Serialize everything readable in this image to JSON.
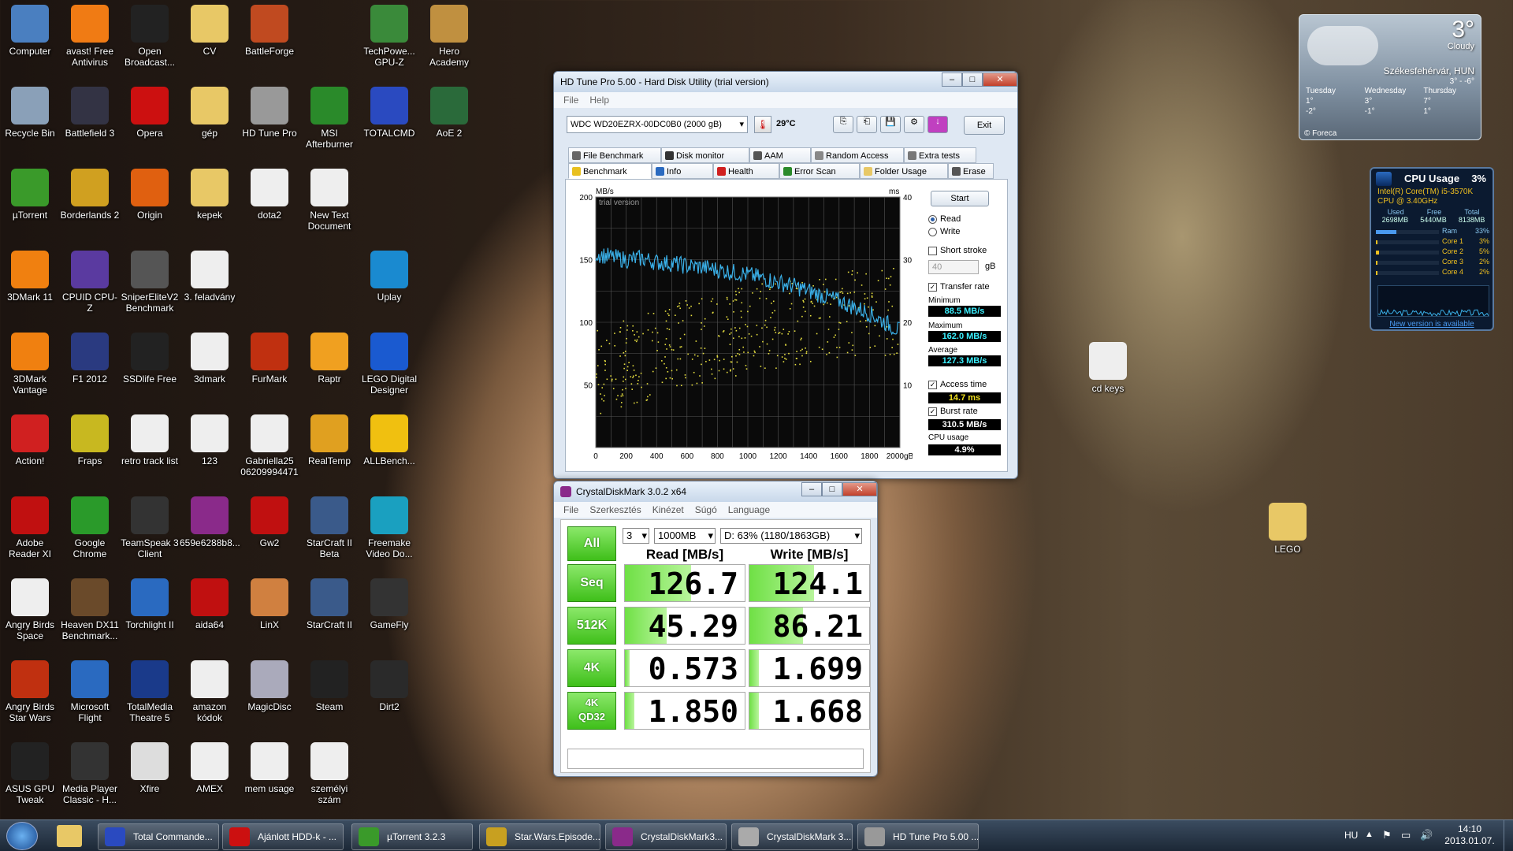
{
  "desktop_icons": [
    {
      "label": "Computer",
      "color": "#4a7fc0"
    },
    {
      "label": "avast! Free Antivirus",
      "color": "#f07b14"
    },
    {
      "label": "Open Broadcast...",
      "color": "#222"
    },
    {
      "label": "CV",
      "color": "#e8c866"
    },
    {
      "label": "BattleForge",
      "color": "#c04a20"
    },
    {
      "label": "TechPowe... GPU-Z",
      "color": "#3a8a3a"
    },
    {
      "label": "Hero Academy",
      "color": "#c09040"
    },
    {
      "label": "Recycle Bin",
      "color": "#8aa0b8"
    },
    {
      "label": "Battlefield 3",
      "color": "#334"
    },
    {
      "label": "Opera",
      "color": "#cc1010"
    },
    {
      "label": "gép",
      "color": "#e8c866"
    },
    {
      "label": "HD Tune Pro",
      "color": "#999"
    },
    {
      "label": "MSI Afterburner",
      "color": "#2a8a2a"
    },
    {
      "label": "TOTALCMD",
      "color": "#2a4ac0"
    },
    {
      "label": "AoE 2",
      "color": "#2a6a3a"
    },
    {
      "label": "µTorrent",
      "color": "#3a9a2a"
    },
    {
      "label": "Borderlands 2",
      "color": "#d0a020"
    },
    {
      "label": "Origin",
      "color": "#e06010"
    },
    {
      "label": "kepek",
      "color": "#e8c866"
    },
    {
      "label": "dota2",
      "color": "#eee"
    },
    {
      "label": "New Text Document",
      "color": "#eee"
    },
    {
      "label": "3DMark 11",
      "color": "#f08010"
    },
    {
      "label": "CPUID CPU-Z",
      "color": "#5a3aa0"
    },
    {
      "label": "SniperEliteV2 Benchmark",
      "color": "#555"
    },
    {
      "label": "3. feladvány",
      "color": "#eee"
    },
    {
      "label": "Uplay",
      "color": "#1a8ad0"
    },
    {
      "label": "3DMark Vantage",
      "color": "#f08010"
    },
    {
      "label": "F1 2012",
      "color": "#2a3a80"
    },
    {
      "label": "SSDlife Free",
      "color": "#222"
    },
    {
      "label": "3dmark",
      "color": "#eee"
    },
    {
      "label": "FurMark",
      "color": "#c03010"
    },
    {
      "label": "Raptr",
      "color": "#f0a020"
    },
    {
      "label": "LEGO Digital Designer",
      "color": "#1a5ad0"
    },
    {
      "label": "Action!",
      "color": "#d02020"
    },
    {
      "label": "Fraps",
      "color": "#c8b820"
    },
    {
      "label": "retro track list",
      "color": "#eee"
    },
    {
      "label": "123",
      "color": "#eee"
    },
    {
      "label": "Gabriella25 06209994471",
      "color": "#eee"
    },
    {
      "label": "RealTemp",
      "color": "#e0a020"
    },
    {
      "label": "ALLBench...",
      "color": "#f0c010"
    },
    {
      "label": "Adobe Reader XI",
      "color": "#c01010"
    },
    {
      "label": "Google Chrome",
      "color": "#2a9a2a"
    },
    {
      "label": "TeamSpeak 3 Client",
      "color": "#333"
    },
    {
      "label": "659e6288b8...",
      "color": "#8a2a8a"
    },
    {
      "label": "Gw2",
      "color": "#c01010"
    },
    {
      "label": "StarCraft II Beta",
      "color": "#3a5a8a"
    },
    {
      "label": "Freemake Video Do...",
      "color": "#1aa0c0"
    },
    {
      "label": "Angry Birds Space",
      "color": "#eee"
    },
    {
      "label": "Heaven DX11 Benchmark...",
      "color": "#6a4a2a"
    },
    {
      "label": "Torchlight II",
      "color": "#2a6ac0"
    },
    {
      "label": "aida64",
      "color": "#c01010"
    },
    {
      "label": "LinX",
      "color": "#d08040"
    },
    {
      "label": "StarCraft II",
      "color": "#3a5a8a"
    },
    {
      "label": "GameFly",
      "color": "#333"
    },
    {
      "label": "Angry Birds Star Wars",
      "color": "#c03010"
    },
    {
      "label": "Microsoft Flight",
      "color": "#2a6ac0"
    },
    {
      "label": "TotalMedia Theatre 5",
      "color": "#1a3a8a"
    },
    {
      "label": "amazon kódok",
      "color": "#eee"
    },
    {
      "label": "MagicDisc",
      "color": "#aab"
    },
    {
      "label": "Steam",
      "color": "#222"
    },
    {
      "label": "Dirt2",
      "color": "#2a2a2a"
    },
    {
      "label": "ASUS GPU Tweak",
      "color": "#222"
    },
    {
      "label": "Media Player Classic - H...",
      "color": "#333"
    },
    {
      "label": "Xfire",
      "color": "#ddd"
    },
    {
      "label": "AMEX",
      "color": "#eee"
    },
    {
      "label": "mem usage",
      "color": "#eee"
    },
    {
      "label": "személyi szám",
      "color": "#eee"
    },
    {
      "label": "cd keys",
      "color": "#eee"
    },
    {
      "label": "LEGO",
      "color": "#e8c866"
    }
  ],
  "hdtune": {
    "title": "HD Tune Pro 5.00 - Hard Disk Utility (trial version)",
    "menu": [
      "File",
      "Help"
    ],
    "drive": "WDC WD20EZRX-00DC0B0 (2000 gB)",
    "temp": "29°C",
    "exit": "Exit",
    "tabs_top": [
      "File Benchmark",
      "Disk monitor",
      "AAM",
      "Random Access",
      "Extra tests"
    ],
    "tabs_bottom": [
      "Benchmark",
      "Info",
      "Health",
      "Error Scan",
      "Folder Usage",
      "Erase"
    ],
    "start": "Start",
    "read": "Read",
    "write": "Write",
    "short_stroke": "Short stroke",
    "stroke_value": "40",
    "gb": "gB",
    "transfer_rate": "Transfer rate",
    "minimum_label": "Minimum",
    "minimum": "88.5 MB/s",
    "maximum_label": "Maximum",
    "maximum": "162.0 MB/s",
    "average_label": "Average",
    "average": "127.3 MB/s",
    "access_label": "Access time",
    "access": "14.7 ms",
    "burst_label": "Burst rate",
    "burst": "310.5 MB/s",
    "cpu_label": "CPU usage",
    "cpu": "4.9%",
    "chart_watermark": "trial version",
    "y_unit_left": "MB/s",
    "y_unit_right": "ms"
  },
  "chart_data": {
    "type": "line",
    "title": "",
    "xlabel": "",
    "ylabel": "MB/s",
    "x_ticks": [
      "0",
      "200",
      "400",
      "600",
      "800",
      "1000",
      "1200",
      "1400",
      "1600",
      "1800",
      "2000gB"
    ],
    "y_ticks_left": [
      "200",
      "150",
      "100",
      "50"
    ],
    "y_ticks_right": [
      "40",
      "30",
      "20",
      "10"
    ],
    "xlim": [
      0,
      2000
    ],
    "ylim": [
      0,
      200
    ],
    "y2lim": [
      0,
      40
    ],
    "series": [
      {
        "name": "Transfer rate",
        "values": [
          {
            "x": 0,
            "y": 155
          },
          {
            "x": 100,
            "y": 152
          },
          {
            "x": 200,
            "y": 150
          },
          {
            "x": 300,
            "y": 151
          },
          {
            "x": 400,
            "y": 148
          },
          {
            "x": 500,
            "y": 147
          },
          {
            "x": 600,
            "y": 145
          },
          {
            "x": 700,
            "y": 144
          },
          {
            "x": 800,
            "y": 142
          },
          {
            "x": 900,
            "y": 140
          },
          {
            "x": 1000,
            "y": 138
          },
          {
            "x": 1100,
            "y": 135
          },
          {
            "x": 1200,
            "y": 132
          },
          {
            "x": 1300,
            "y": 129
          },
          {
            "x": 1400,
            "y": 125
          },
          {
            "x": 1500,
            "y": 121
          },
          {
            "x": 1600,
            "y": 117
          },
          {
            "x": 1700,
            "y": 112
          },
          {
            "x": 1800,
            "y": 107
          },
          {
            "x": 1900,
            "y": 100
          },
          {
            "x": 2000,
            "y": 93
          }
        ]
      },
      {
        "name": "Access time",
        "values": [
          {
            "x": 0,
            "y": 12
          },
          {
            "x": 500,
            "y": 16
          },
          {
            "x": 1000,
            "y": 19
          },
          {
            "x": 1500,
            "y": 21
          },
          {
            "x": 2000,
            "y": 22
          }
        ]
      }
    ],
    "grid": true
  },
  "cdm": {
    "title": "CrystalDiskMark 3.0.2 x64",
    "menu": [
      "File",
      "Szerkesztés",
      "Kinézet",
      "Súgó",
      "Language"
    ],
    "all": "All",
    "count": "3",
    "size": "1000MB",
    "drive": "D: 63% (1180/1863GB)",
    "read_header": "Read [MB/s]",
    "write_header": "Write [MB/s]",
    "rows": [
      {
        "label": "Seq",
        "read": "126.7",
        "write": "124.1",
        "rf": 0.55,
        "wf": 0.54
      },
      {
        "label": "512K",
        "read": "45.29",
        "write": "86.21",
        "rf": 0.35,
        "wf": 0.45
      },
      {
        "label": "4K",
        "read": "0.573",
        "write": "1.699",
        "rf": 0.04,
        "wf": 0.08
      },
      {
        "label": "4K QD32",
        "read": "1.850",
        "write": "1.668",
        "rf": 0.08,
        "wf": 0.08
      }
    ]
  },
  "weather": {
    "temp": "3°",
    "cond": "Cloudy",
    "city": "Székesfehérvár, HUN",
    "range": "3° - -6°",
    "days": [
      {
        "d": "Tuesday",
        "t": "1°",
        "l": "-2°"
      },
      {
        "d": "Wednesday",
        "t": "3°",
        "l": "-1°"
      },
      {
        "d": "Thursday",
        "t": "7°",
        "l": "1°"
      }
    ],
    "brand": "© Foreca"
  },
  "cpu_gadget": {
    "title": "CPU Usage",
    "pct": "3%",
    "cpu_name": "Intel(R) Core(TM) i5-3570K",
    "clock": "CPU @ 3.40GHz",
    "mem_headers": [
      "Used",
      "Free",
      "Total"
    ],
    "mem_values": [
      "2698MB",
      "5440MB",
      "8138MB"
    ],
    "rows": [
      {
        "n": "Ram",
        "v": "33%",
        "f": 0.33
      },
      {
        "n": "Core 1",
        "v": "3%",
        "f": 0.03
      },
      {
        "n": "Core 2",
        "v": "5%",
        "f": 0.05
      },
      {
        "n": "Core 3",
        "v": "2%",
        "f": 0.02
      },
      {
        "n": "Core 4",
        "v": "2%",
        "f": 0.02
      }
    ],
    "link": "New version is available"
  },
  "taskbar": {
    "items": [
      {
        "label": "Total Commande...",
        "color": "#2a4ac0"
      },
      {
        "label": "Ajánlott HDD-k - ...",
        "color": "#cc1010"
      },
      {
        "label": "µTorrent 3.2.3",
        "color": "#3a9a2a"
      },
      {
        "label": "Star.Wars.Episode...",
        "color": "#c8a020"
      },
      {
        "label": "CrystalDiskMark3...",
        "color": "#8a2a8a"
      },
      {
        "label": "CrystalDiskMark 3...",
        "color": "#aaa"
      },
      {
        "label": "HD Tune Pro 5.00 ...",
        "color": "#999"
      }
    ],
    "lang": "HU",
    "time": "14:10",
    "date": "2013.01.07."
  }
}
